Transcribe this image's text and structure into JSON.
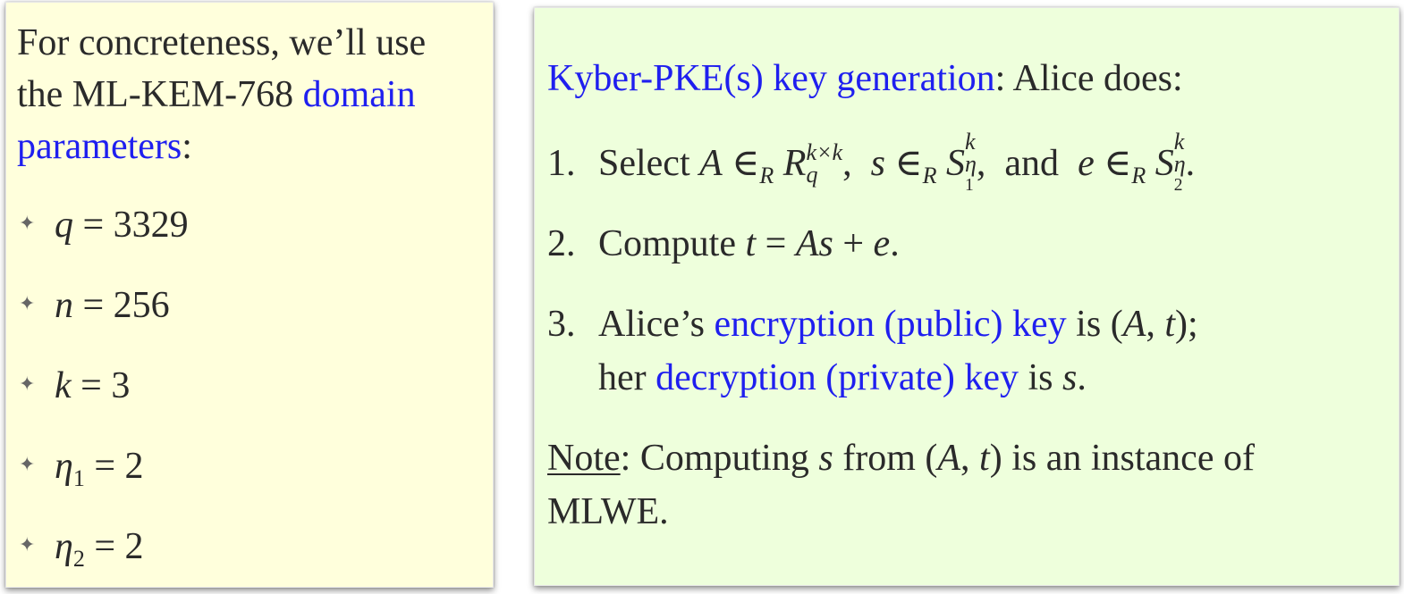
{
  "left_panel": {
    "intro_line1": "For concreteness, we’ll use",
    "intro_line2_plain": "the ML-KEM-768 ",
    "intro_line2_link": "domain",
    "intro_line3_link": "parameters",
    "intro_line3_colon": ":",
    "params": [
      {
        "symbol": "q",
        "subscript": "",
        "value": "= 3329"
      },
      {
        "symbol": "n",
        "subscript": "",
        "value": "= 256"
      },
      {
        "symbol": "k",
        "subscript": "",
        "value": "= 3"
      },
      {
        "symbol": "η",
        "subscript": "1",
        "value": "= 2"
      },
      {
        "symbol": "η",
        "subscript": "2",
        "value": "= 2"
      }
    ]
  },
  "right_panel": {
    "heading_link": "Kyber-PKE(s) key generation",
    "heading_rest": ": Alice does:",
    "steps": [
      {
        "num": "1.",
        "text": "Select"
      },
      {
        "num": "2.",
        "text": "Compute"
      },
      {
        "num": "3.",
        "text_a": "Alice’s ",
        "link_a": "encryption (public) key",
        "text_b": " is ",
        "text_c": "her ",
        "link_b": "decryption (private) key",
        "text_d": " is "
      }
    ],
    "and_word": "and",
    "note_label": "Note",
    "note_text_a": ": Computing ",
    "note_text_b": " from ",
    "note_text_c": " is an instance of",
    "note_text_d": "MLWE."
  },
  "colors": {
    "left_bg": "#ffffdc",
    "right_bg": "#eeffdc",
    "link": "#1f1fef",
    "text": "#2a2a2a"
  }
}
